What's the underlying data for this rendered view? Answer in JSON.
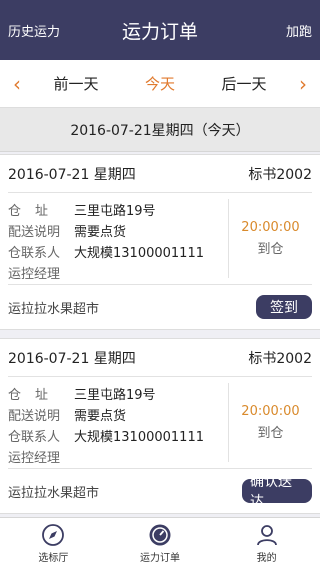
{
  "header": {
    "left": "历史运力",
    "title": "运力订单",
    "right": "加跑"
  },
  "daynav": {
    "prev": "前一天",
    "today": "今天",
    "next": "后一天"
  },
  "date_banner": "2016-07-21星期四（今天）",
  "orders": [
    {
      "date": "2016-07-21 星期四",
      "bid": "标书2002",
      "address_label": "仓址",
      "address": "三里屯路19号",
      "note_label": "配送说明",
      "note": "需要点货",
      "contact_label": "仓联系人",
      "contact": "大规模13100001111",
      "manager_label": "运控经理",
      "manager": "",
      "time": "20:00:00",
      "status": "到仓",
      "shipper": "运拉拉水果超市",
      "action": "签到"
    },
    {
      "date": "2016-07-21 星期四",
      "bid": "标书2002",
      "address_label": "仓址",
      "address": "三里屯路19号",
      "note_label": "配送说明",
      "note": "需要点货",
      "contact_label": "仓联系人",
      "contact": "大规模13100001111",
      "manager_label": "运控经理",
      "manager": "",
      "time": "20:00:00",
      "status": "到仓",
      "shipper": "运拉拉水果超市",
      "action": "确认送达"
    }
  ],
  "tabs": [
    {
      "label": "选标厅",
      "icon": "compass-icon"
    },
    {
      "label": "运力订单",
      "icon": "gauge-icon"
    },
    {
      "label": "我的",
      "icon": "user-icon"
    }
  ],
  "colors": {
    "primary": "#3c3d63",
    "accent": "#e07a2e",
    "time": "#d98a2c"
  }
}
